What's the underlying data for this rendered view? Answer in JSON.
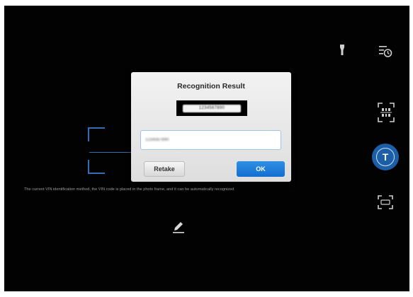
{
  "dialog": {
    "title": "Recognition Result",
    "vin_image_text": "1234567890",
    "vin_input_value": "1234567890",
    "retake_label": "Retake",
    "ok_label": "OK"
  },
  "hint_text": "The current VIN identification method, the VIN code is placed in the photo frame, and it can be automatically recognized",
  "ocr_button_label": "T",
  "icons": {
    "flash": "flashlight-icon",
    "history": "history-icon",
    "scan_vin": "scan-code-icon",
    "ocr": "text-recognition-icon",
    "scan_plate": "scan-plate-icon",
    "edit": "edit-pencil-icon"
  },
  "colors": {
    "accent": "#1c5fa8",
    "ok_button": "#1a7fdb",
    "frame": "#2e6fb8"
  }
}
